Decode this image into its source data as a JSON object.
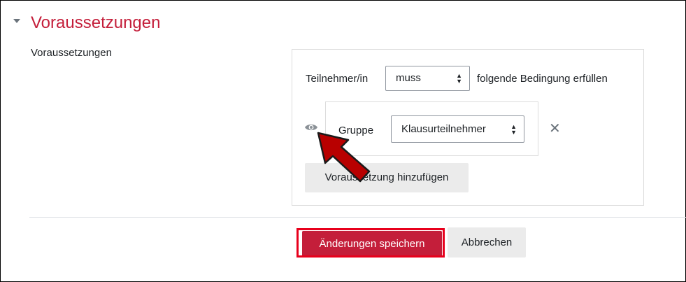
{
  "section": {
    "title": "Voraussetzungen"
  },
  "field": {
    "label": "Voraussetzungen"
  },
  "availability": {
    "participant_label": "Teilnehmer/in",
    "must_select_value": "muss",
    "condition_text": "folgende Bedingung erfüllen",
    "condition": {
      "type_label": "Gruppe",
      "group_select_value": "Klausurteilnehmer"
    },
    "add_button_label": "Voraussetzung hinzufügen"
  },
  "actions": {
    "save_label": "Änderungen speichern",
    "cancel_label": "Abbrechen"
  },
  "colors": {
    "accent": "#c41e3a",
    "highlight": "#e8001c",
    "arrow": "#b80000"
  },
  "icons": {
    "collapse": "chevron-down-icon",
    "visibility": "eye-icon",
    "remove": "close-icon"
  }
}
